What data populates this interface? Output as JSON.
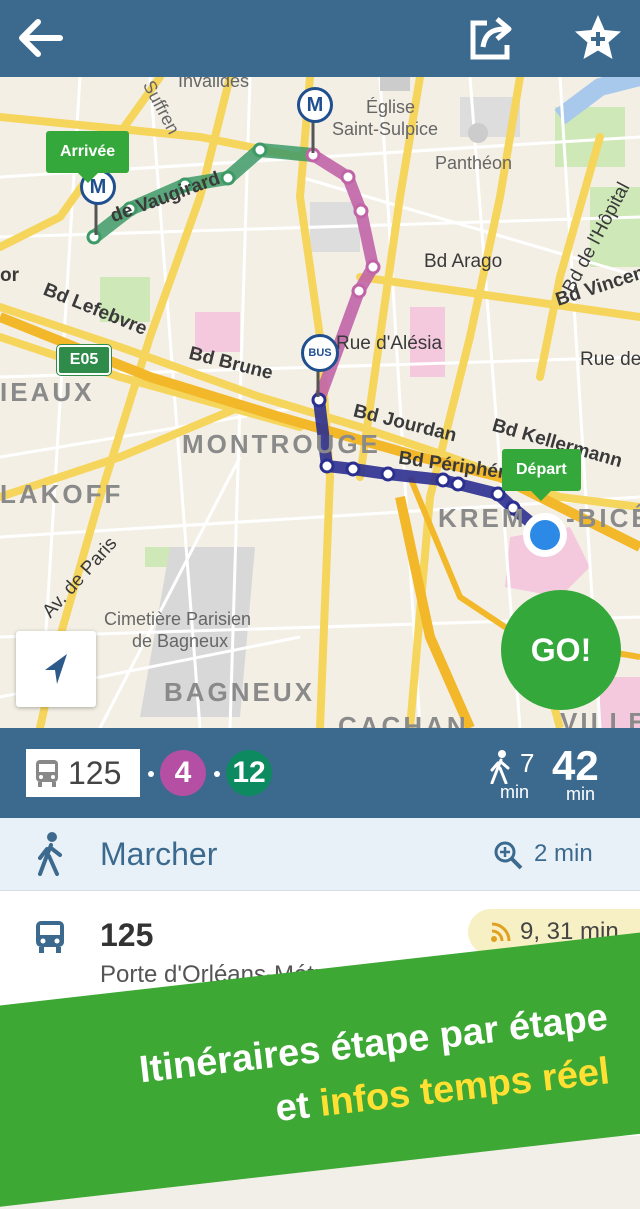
{
  "header": {
    "back_icon": "arrow-left-icon",
    "share_icon": "share-icon",
    "favorite_icon": "star-plus-icon"
  },
  "map": {
    "labels": {
      "invalides": "Invalides",
      "sevres": "Suffren",
      "eglise": "Église",
      "saint_sulpice": "Saint-Sulpice",
      "pantheon": "Panthéon",
      "vaugirard": "de Vaugirard",
      "bd_arago": "Bd Arago",
      "bd_hopital": "Bd de l'Hôpital",
      "bd_vincent": "Bd Vincent",
      "bd_lefebvre": "Bd Lefebvre",
      "bd_brune": "Bd Brune",
      "rue_alesia": "Rue d'Alésia",
      "bd_jourdan": "Bd Jourdan",
      "bd_kellermann": "Bd Kellermann",
      "bd_peripherique": "Bd Périphér",
      "montrouge": "MONTROUGE",
      "malakoff": "LAKOFF",
      "vanves": "IEAUX",
      "kremlin": "KREM",
      "bicetre": "-BICÊ",
      "av_paris": "Av. de Paris",
      "cimetiere_1": "Cimetière Parisien",
      "cimetiere_2": "de Bagneux",
      "bagneux": "BAGNEUX",
      "cachan": "CACHAN",
      "ville": "VILLE",
      "rue_de": "Rue de",
      "or_label": "or"
    },
    "road_badge": "E05",
    "metro_badge": "M",
    "bus_badge": "BUS",
    "arrivee": "Arrivée",
    "depart": "Départ",
    "locate_icon": "navigation-arrow-icon",
    "go_label": "GO!"
  },
  "summary": {
    "bus_icon": "bus-icon",
    "bus_line": "125",
    "separator": "·",
    "line_4": "4",
    "line_12": "12",
    "line_4_color": "#b44fa3",
    "line_12_color": "#0e8a61",
    "walk_icon": "walking-person-icon",
    "walk_minutes": "7",
    "walk_unit": "min",
    "total_minutes": "42",
    "total_unit": "min"
  },
  "steps": [
    {
      "icon": "walking-person-icon",
      "title": "Marcher",
      "zoom_icon": "zoom-in-icon",
      "duration": "2 min"
    },
    {
      "icon": "bus-icon",
      "title": "125",
      "subtitle": "Porte d'Orléans-Métro",
      "realtime_icon": "realtime-signal-icon",
      "realtime": "9, 31 min"
    }
  ],
  "promo": {
    "line1": "Itinéraires étape par étape",
    "line2_prefix": "et",
    "line2_highlight": "infos temps réel",
    "highlight_color": "#ffe033"
  }
}
